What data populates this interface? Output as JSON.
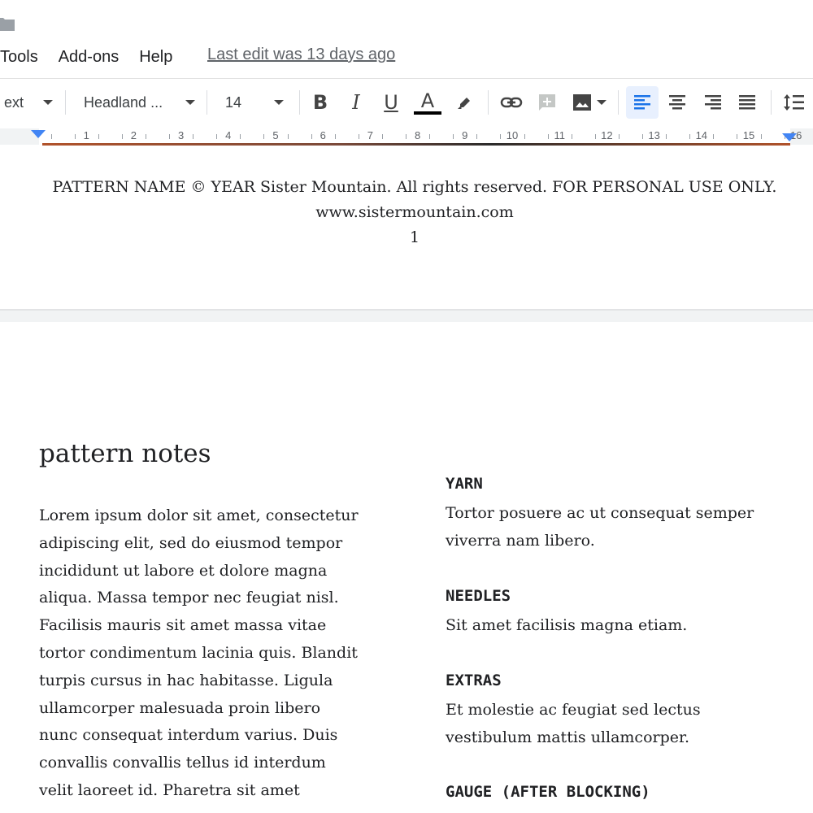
{
  "menu": {
    "items": [
      "Tools",
      "Add-ons",
      "Help"
    ],
    "last_edit": "Last edit was 13 days ago"
  },
  "toolbar": {
    "style_value": "ext",
    "font_value": "Headland ...",
    "size_value": "14",
    "bold_label": "B",
    "italic_label": "I",
    "underline_label": "U",
    "text_color_label": "A",
    "text_color": "#000000"
  },
  "ruler": {
    "numbers": [
      "1",
      "2",
      "3",
      "4",
      "5",
      "6",
      "7",
      "8",
      "9",
      "10",
      "11",
      "12",
      "13",
      "14",
      "15",
      "16"
    ]
  },
  "footer": {
    "line1": "PATTERN NAME © YEAR Sister Mountain. All rights reserved. FOR PERSONAL USE ONLY.",
    "line2": "www.sistermountain.com",
    "page_number": "1"
  },
  "document": {
    "heading": "pattern notes",
    "body_lines": [
      "Lorem ipsum dolor sit amet, consectetur",
      "adipiscing elit, sed do eiusmod tempor",
      "incididunt ut labore et dolore magna",
      "aliqua. Massa tempor nec feugiat nisl.",
      "Facilisis mauris sit amet massa vitae",
      "tortor condimentum lacinia quis. Blandit",
      "turpis cursus in hac habitasse. Ligula",
      "ullamcorper malesuada proin libero",
      "nunc consequat interdum varius. Duis",
      "convallis convallis tellus id interdum",
      "velit laoreet id. Pharetra sit amet"
    ],
    "yarn_label": "YARN",
    "yarn_lines": [
      "Tortor posuere ac ut consequat semper",
      "viverra nam libero."
    ],
    "needles_label": "NEEDLES",
    "needles_text": "Sit amet facilisis magna etiam.",
    "extras_label": "EXTRAS",
    "extras_lines": [
      "Et molestie ac feugiat sed lectus",
      "vestibulum mattis ullamcorper."
    ],
    "gauge_label": "GAUGE (AFTER BLOCKING)"
  },
  "colors": {
    "accent_blue": "#4285f4",
    "active_button_bg": "#e8f0fe"
  },
  "icons": [
    "folder-icon",
    "dropdown-caret-icon",
    "text-color-icon",
    "highlight-icon",
    "link-icon",
    "add-comment-icon",
    "insert-image-icon",
    "align-left-icon",
    "align-center-icon",
    "align-right-icon",
    "justify-icon",
    "line-spacing-icon",
    "indent-marker-icon"
  ]
}
